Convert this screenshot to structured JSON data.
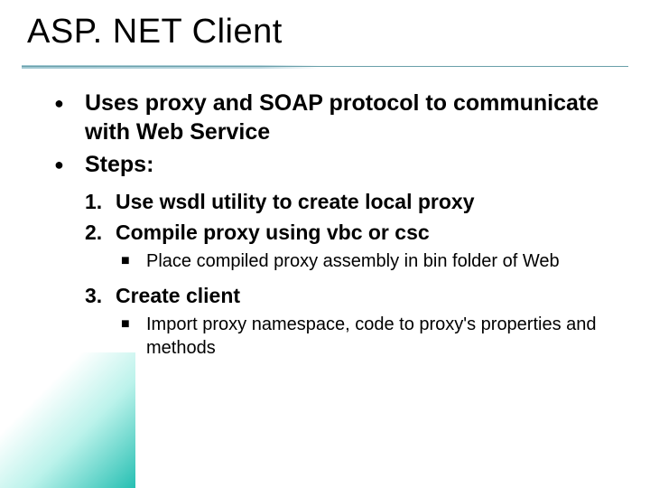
{
  "title": "ASP. NET Client",
  "bullets": [
    "Uses proxy and SOAP protocol to communicate with Web Service",
    "Steps:"
  ],
  "steps": [
    {
      "num": "1.",
      "text": "Use wsdl utility to create local proxy",
      "sub": []
    },
    {
      "num": "2.",
      "text": "Compile proxy using vbc or csc",
      "sub": [
        "Place compiled proxy assembly in bin folder of Web"
      ]
    },
    {
      "num": "3.",
      "text": "Create client",
      "sub": [
        "Import proxy namespace, code to proxy's properties and methods"
      ]
    }
  ],
  "glyphs": {
    "round_bullet": "●",
    "square_bullet": "■"
  }
}
